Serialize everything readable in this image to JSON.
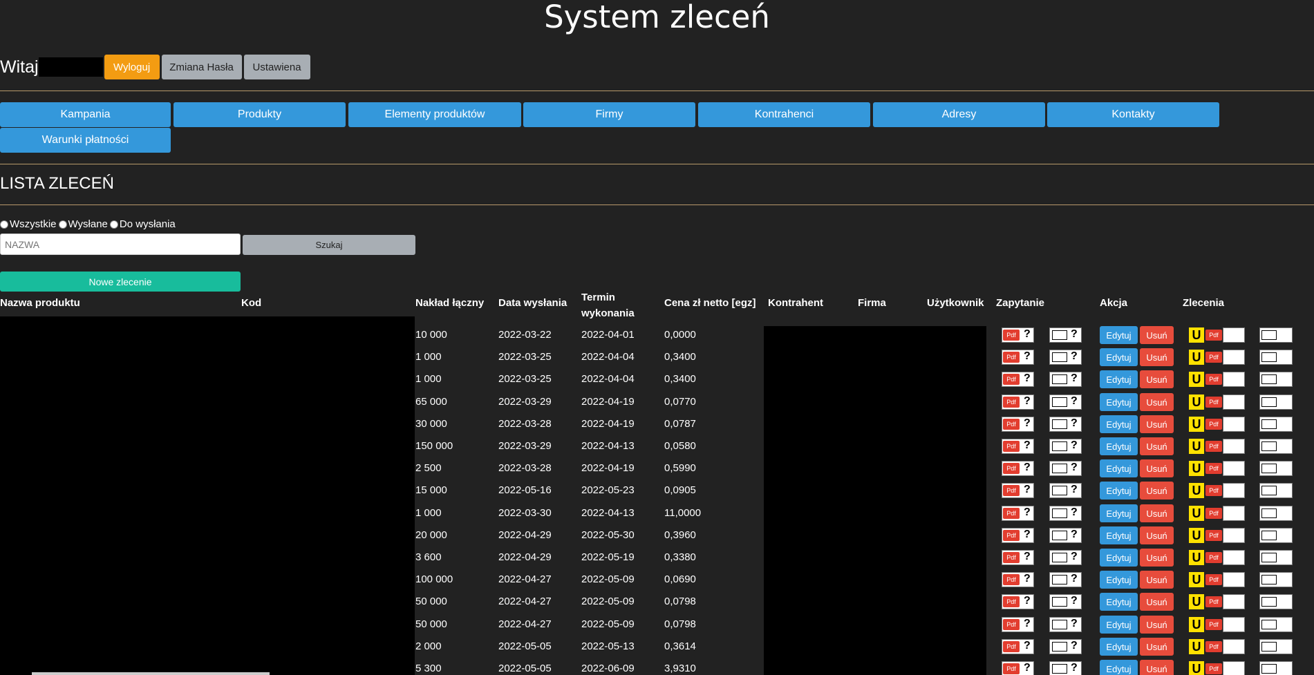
{
  "app": {
    "title": "System zleceń"
  },
  "header": {
    "welcome": "Witaj",
    "logout": "Wyloguj",
    "change_password": "Zmiana Hasła",
    "settings": "Ustawiena"
  },
  "nav": {
    "items": [
      "Kampania",
      "Produkty",
      "Elementy produktów",
      "Firmy",
      "Kontrahenci",
      "Adresy",
      "Kontakty",
      "Warunki płatności"
    ]
  },
  "section": {
    "title": "LISTA ZLECEŃ"
  },
  "filters": {
    "radios": [
      "Wszystkie",
      "Wysłane",
      "Do wysłania"
    ],
    "search_placeholder": "NAZWA",
    "search_button": "Szukaj",
    "new_order_button": "Nowe zlecenie"
  },
  "table": {
    "headers": {
      "product": "Nazwa produktu",
      "code": "Kod",
      "qty": "Nakład łączny",
      "sent": "Data wysłania",
      "deadline": "Termin wykonania",
      "price": "Cena zł netto [egz]",
      "contractor": "Kontrahent",
      "company": "Firma",
      "user": "Użytkownik",
      "inquiry": "Zapytanie",
      "action": "Akcja",
      "orders": "Zlecenia"
    },
    "edit_label": "Edytuj",
    "delete_label": "Usuń",
    "pdf_label": "Pdf",
    "q_label": "?",
    "u_label": "U",
    "rows": [
      {
        "qty": "10 000",
        "sent": "2022-03-22",
        "deadline": "2022-04-01",
        "price": "0,0000"
      },
      {
        "qty": "1 000",
        "sent": "2022-03-25",
        "deadline": "2022-04-04",
        "price": "0,3400"
      },
      {
        "qty": "1 000",
        "sent": "2022-03-25",
        "deadline": "2022-04-04",
        "price": "0,3400"
      },
      {
        "qty": "65 000",
        "sent": "2022-03-29",
        "deadline": "2022-04-19",
        "price": "0,0770"
      },
      {
        "qty": "30 000",
        "sent": "2022-03-28",
        "deadline": "2022-04-19",
        "price": "0,0787"
      },
      {
        "qty": "150 000",
        "sent": "2022-03-29",
        "deadline": "2022-04-13",
        "price": "0,0580"
      },
      {
        "qty": "2 500",
        "sent": "2022-03-28",
        "deadline": "2022-04-19",
        "price": "0,5990"
      },
      {
        "qty": "15 000",
        "sent": "2022-05-16",
        "deadline": "2022-05-23",
        "price": "0,0905"
      },
      {
        "qty": "1 000",
        "sent": "2022-03-30",
        "deadline": "2022-04-13",
        "price": "11,0000"
      },
      {
        "qty": "20 000",
        "sent": "2022-04-29",
        "deadline": "2022-05-30",
        "price": "0,3960"
      },
      {
        "qty": "3 600",
        "sent": "2022-04-29",
        "deadline": "2022-05-19",
        "price": "0,3380"
      },
      {
        "qty": "100 000",
        "sent": "2022-04-27",
        "deadline": "2022-05-09",
        "price": "0,0690"
      },
      {
        "qty": "50 000",
        "sent": "2022-04-27",
        "deadline": "2022-05-09",
        "price": "0,0798"
      },
      {
        "qty": "50 000",
        "sent": "2022-04-27",
        "deadline": "2022-05-09",
        "price": "0,0798"
      },
      {
        "qty": "2 000",
        "sent": "2022-05-05",
        "deadline": "2022-05-13",
        "price": "0,3614"
      },
      {
        "qty": "5 300",
        "sent": "2022-05-05",
        "deadline": "2022-06-09",
        "price": "3,9310"
      }
    ]
  }
}
